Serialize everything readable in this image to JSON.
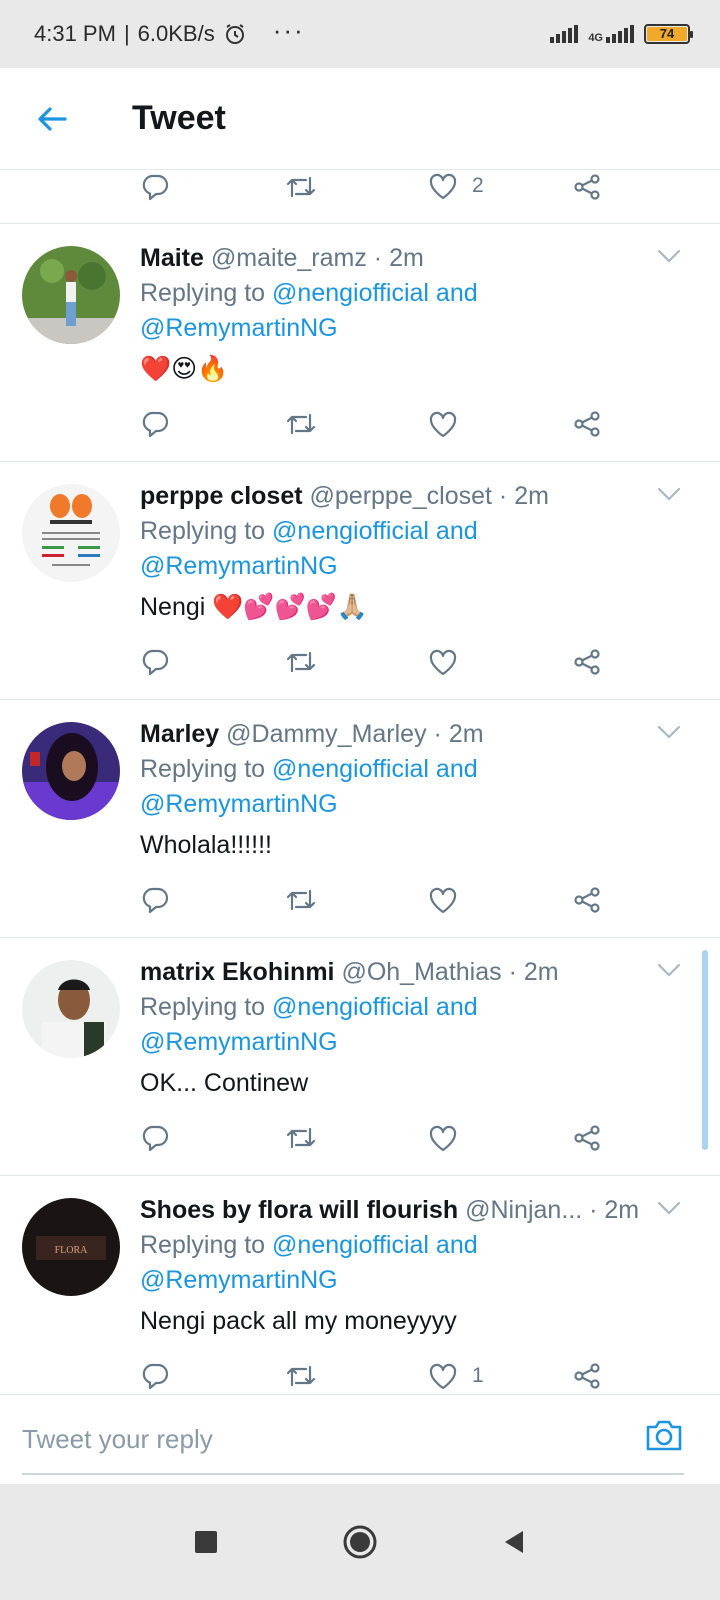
{
  "status_bar": {
    "time": "4:31 PM",
    "speed": "6.0KB/s",
    "more": "···",
    "network": "4G",
    "battery": "74"
  },
  "header": {
    "title": "Tweet"
  },
  "top_actions": {
    "like_count": "2"
  },
  "replying_prefix": "Replying to",
  "tweets": [
    {
      "name": "Maite",
      "handle": "@maite_ramz",
      "time": "2m",
      "mention1": "@nengiofficial and",
      "mention2": "@RemymartinNG",
      "text": "❤️😍🔥",
      "like_count": ""
    },
    {
      "name": "perppe closet",
      "handle": "@perppe_closet",
      "time": "2m",
      "mention1": "@nengiofficial and",
      "mention2": "@RemymartinNG",
      "text": "Nengi ❤️💕💕💕🙏🏼",
      "like_count": ""
    },
    {
      "name": "Marley",
      "handle": "@Dammy_Marley",
      "time": "2m",
      "mention1": "@nengiofficial and",
      "mention2": "@RemymartinNG",
      "text": "Wholala!!!!!!",
      "like_count": ""
    },
    {
      "name": "matrix Ekohinmi",
      "handle": "@Oh_Mathias",
      "time": "2m",
      "mention1": "@nengiofficial and",
      "mention2": "@RemymartinNG",
      "text": "OK... Continew",
      "like_count": ""
    },
    {
      "name": "Shoes by flora will flourish",
      "handle": "@Ninjan...",
      "time": "2m",
      "mention1": "@nengiofficial and",
      "mention2": "@RemymartinNG",
      "text": "Nengi pack all my moneyyyy",
      "like_count": "1"
    }
  ],
  "reply_bar": {
    "placeholder": "Tweet your reply"
  },
  "colors": {
    "accent": "#1b95e0",
    "muted": "#657786",
    "border": "#e1e8ed"
  }
}
